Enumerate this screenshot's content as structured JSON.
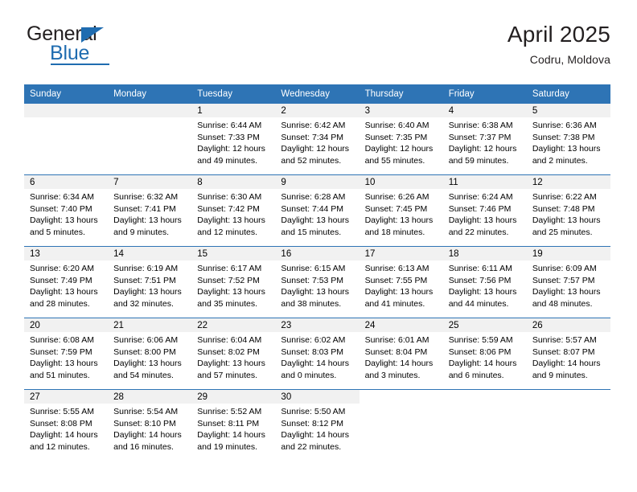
{
  "brand": {
    "name_top": "General",
    "name_bottom": "Blue"
  },
  "header": {
    "month_title": "April 2025",
    "location": "Codru, Moldova"
  },
  "colors": {
    "header_blue": "#2e74b5",
    "brand_blue": "#1f6cb0",
    "day_band_gray": "#f1f1f1"
  },
  "calendar": {
    "weekday_headers": [
      "Sunday",
      "Monday",
      "Tuesday",
      "Wednesday",
      "Thursday",
      "Friday",
      "Saturday"
    ],
    "weeks": [
      [
        {
          "empty": true
        },
        {
          "empty": true
        },
        {
          "day": "1",
          "sunrise": "Sunrise: 6:44 AM",
          "sunset": "Sunset: 7:33 PM",
          "daylight_1": "Daylight: 12 hours",
          "daylight_2": "and 49 minutes."
        },
        {
          "day": "2",
          "sunrise": "Sunrise: 6:42 AM",
          "sunset": "Sunset: 7:34 PM",
          "daylight_1": "Daylight: 12 hours",
          "daylight_2": "and 52 minutes."
        },
        {
          "day": "3",
          "sunrise": "Sunrise: 6:40 AM",
          "sunset": "Sunset: 7:35 PM",
          "daylight_1": "Daylight: 12 hours",
          "daylight_2": "and 55 minutes."
        },
        {
          "day": "4",
          "sunrise": "Sunrise: 6:38 AM",
          "sunset": "Sunset: 7:37 PM",
          "daylight_1": "Daylight: 12 hours",
          "daylight_2": "and 59 minutes."
        },
        {
          "day": "5",
          "sunrise": "Sunrise: 6:36 AM",
          "sunset": "Sunset: 7:38 PM",
          "daylight_1": "Daylight: 13 hours",
          "daylight_2": "and 2 minutes."
        }
      ],
      [
        {
          "day": "6",
          "sunrise": "Sunrise: 6:34 AM",
          "sunset": "Sunset: 7:40 PM",
          "daylight_1": "Daylight: 13 hours",
          "daylight_2": "and 5 minutes."
        },
        {
          "day": "7",
          "sunrise": "Sunrise: 6:32 AM",
          "sunset": "Sunset: 7:41 PM",
          "daylight_1": "Daylight: 13 hours",
          "daylight_2": "and 9 minutes."
        },
        {
          "day": "8",
          "sunrise": "Sunrise: 6:30 AM",
          "sunset": "Sunset: 7:42 PM",
          "daylight_1": "Daylight: 13 hours",
          "daylight_2": "and 12 minutes."
        },
        {
          "day": "9",
          "sunrise": "Sunrise: 6:28 AM",
          "sunset": "Sunset: 7:44 PM",
          "daylight_1": "Daylight: 13 hours",
          "daylight_2": "and 15 minutes."
        },
        {
          "day": "10",
          "sunrise": "Sunrise: 6:26 AM",
          "sunset": "Sunset: 7:45 PM",
          "daylight_1": "Daylight: 13 hours",
          "daylight_2": "and 18 minutes."
        },
        {
          "day": "11",
          "sunrise": "Sunrise: 6:24 AM",
          "sunset": "Sunset: 7:46 PM",
          "daylight_1": "Daylight: 13 hours",
          "daylight_2": "and 22 minutes."
        },
        {
          "day": "12",
          "sunrise": "Sunrise: 6:22 AM",
          "sunset": "Sunset: 7:48 PM",
          "daylight_1": "Daylight: 13 hours",
          "daylight_2": "and 25 minutes."
        }
      ],
      [
        {
          "day": "13",
          "sunrise": "Sunrise: 6:20 AM",
          "sunset": "Sunset: 7:49 PM",
          "daylight_1": "Daylight: 13 hours",
          "daylight_2": "and 28 minutes."
        },
        {
          "day": "14",
          "sunrise": "Sunrise: 6:19 AM",
          "sunset": "Sunset: 7:51 PM",
          "daylight_1": "Daylight: 13 hours",
          "daylight_2": "and 32 minutes."
        },
        {
          "day": "15",
          "sunrise": "Sunrise: 6:17 AM",
          "sunset": "Sunset: 7:52 PM",
          "daylight_1": "Daylight: 13 hours",
          "daylight_2": "and 35 minutes."
        },
        {
          "day": "16",
          "sunrise": "Sunrise: 6:15 AM",
          "sunset": "Sunset: 7:53 PM",
          "daylight_1": "Daylight: 13 hours",
          "daylight_2": "and 38 minutes."
        },
        {
          "day": "17",
          "sunrise": "Sunrise: 6:13 AM",
          "sunset": "Sunset: 7:55 PM",
          "daylight_1": "Daylight: 13 hours",
          "daylight_2": "and 41 minutes."
        },
        {
          "day": "18",
          "sunrise": "Sunrise: 6:11 AM",
          "sunset": "Sunset: 7:56 PM",
          "daylight_1": "Daylight: 13 hours",
          "daylight_2": "and 44 minutes."
        },
        {
          "day": "19",
          "sunrise": "Sunrise: 6:09 AM",
          "sunset": "Sunset: 7:57 PM",
          "daylight_1": "Daylight: 13 hours",
          "daylight_2": "and 48 minutes."
        }
      ],
      [
        {
          "day": "20",
          "sunrise": "Sunrise: 6:08 AM",
          "sunset": "Sunset: 7:59 PM",
          "daylight_1": "Daylight: 13 hours",
          "daylight_2": "and 51 minutes."
        },
        {
          "day": "21",
          "sunrise": "Sunrise: 6:06 AM",
          "sunset": "Sunset: 8:00 PM",
          "daylight_1": "Daylight: 13 hours",
          "daylight_2": "and 54 minutes."
        },
        {
          "day": "22",
          "sunrise": "Sunrise: 6:04 AM",
          "sunset": "Sunset: 8:02 PM",
          "daylight_1": "Daylight: 13 hours",
          "daylight_2": "and 57 minutes."
        },
        {
          "day": "23",
          "sunrise": "Sunrise: 6:02 AM",
          "sunset": "Sunset: 8:03 PM",
          "daylight_1": "Daylight: 14 hours",
          "daylight_2": "and 0 minutes."
        },
        {
          "day": "24",
          "sunrise": "Sunrise: 6:01 AM",
          "sunset": "Sunset: 8:04 PM",
          "daylight_1": "Daylight: 14 hours",
          "daylight_2": "and 3 minutes."
        },
        {
          "day": "25",
          "sunrise": "Sunrise: 5:59 AM",
          "sunset": "Sunset: 8:06 PM",
          "daylight_1": "Daylight: 14 hours",
          "daylight_2": "and 6 minutes."
        },
        {
          "day": "26",
          "sunrise": "Sunrise: 5:57 AM",
          "sunset": "Sunset: 8:07 PM",
          "daylight_1": "Daylight: 14 hours",
          "daylight_2": "and 9 minutes."
        }
      ],
      [
        {
          "day": "27",
          "sunrise": "Sunrise: 5:55 AM",
          "sunset": "Sunset: 8:08 PM",
          "daylight_1": "Daylight: 14 hours",
          "daylight_2": "and 12 minutes."
        },
        {
          "day": "28",
          "sunrise": "Sunrise: 5:54 AM",
          "sunset": "Sunset: 8:10 PM",
          "daylight_1": "Daylight: 14 hours",
          "daylight_2": "and 16 minutes."
        },
        {
          "day": "29",
          "sunrise": "Sunrise: 5:52 AM",
          "sunset": "Sunset: 8:11 PM",
          "daylight_1": "Daylight: 14 hours",
          "daylight_2": "and 19 minutes."
        },
        {
          "day": "30",
          "sunrise": "Sunrise: 5:50 AM",
          "sunset": "Sunset: 8:12 PM",
          "daylight_1": "Daylight: 14 hours",
          "daylight_2": "and 22 minutes."
        },
        {
          "empty": true,
          "no_band": true
        },
        {
          "empty": true,
          "no_band": true
        },
        {
          "empty": true,
          "no_band": true
        }
      ]
    ]
  }
}
